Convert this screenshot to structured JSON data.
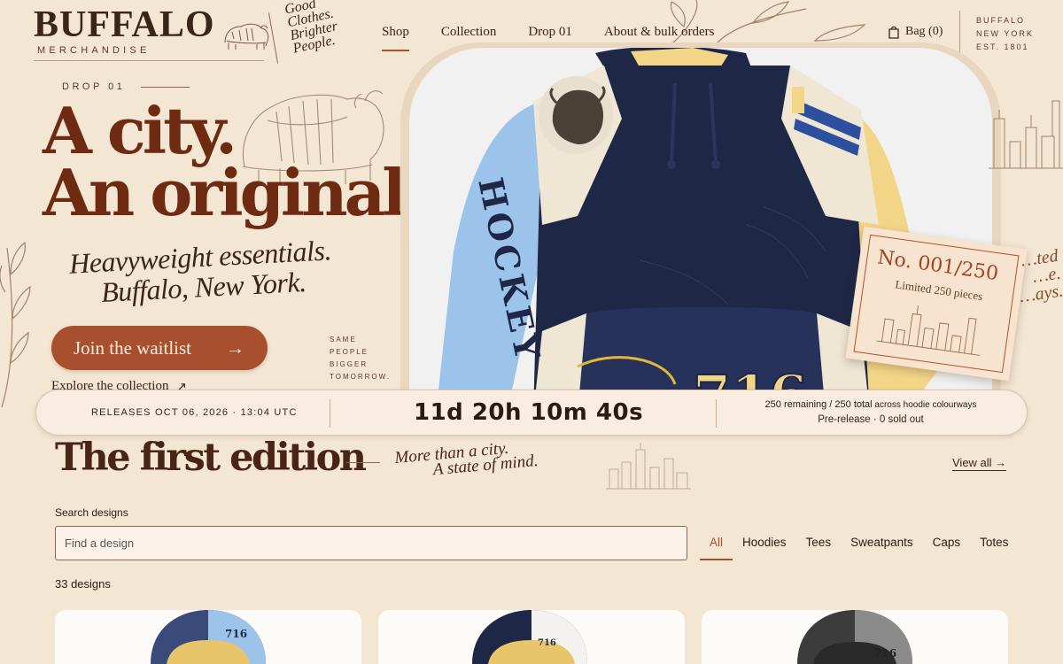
{
  "header": {
    "brand": "BUFFALO",
    "brand_sub": "MERCHANDISE",
    "slogan": [
      "Good",
      "Clothes.",
      "Brighter",
      "People."
    ],
    "nav": [
      "Shop",
      "Collection",
      "Drop 01",
      "About & bulk orders"
    ],
    "bag_label": "Bag (0)",
    "city_lines": [
      "BUFFALO",
      "NEW YORK",
      "EST. 1801"
    ]
  },
  "hero": {
    "drop_label": "DROP 01",
    "title_l1": "A city.",
    "title_l2": "An original.",
    "sub_l1": "Heavyweight essentials.",
    "sub_l2": "Buffalo, New York.",
    "waitlist_label": "Join the waitlist",
    "waitlist_arrow": "→",
    "poem": [
      "SAME",
      "PEOPLE",
      "BIGGER",
      "TOMORROW."
    ],
    "explore_label": "Explore the collection",
    "explore_arrow": "↗",
    "hoodie_sleeve_text": "HOCKEY",
    "hoodie_chest_text": "716",
    "card_number": "No. 001/250",
    "card_sub": "Limited 250 pieces",
    "side_script": [
      "…ted",
      "…e.",
      "…ays."
    ]
  },
  "countdown": {
    "release": "RELEASES OCT 06, 2026 · 13:04 UTC",
    "timer": "11d 20h 10m 40s",
    "remaining_strong": "250 remaining / 250 total",
    "remaining_rest": " across hoodie colourways",
    "status": "Pre-release · 0 sold out"
  },
  "section": {
    "title": "The first edition",
    "script_l1": "More than a city.",
    "script_l2": "A state of mind.",
    "view_all": "View all →"
  },
  "search": {
    "label": "Search designs",
    "placeholder": "Find a design",
    "value": ""
  },
  "filters": [
    "All",
    "Hoodies",
    "Tees",
    "Sweatpants",
    "Caps",
    "Totes"
  ],
  "active_filter": "All",
  "count_text": "33 designs",
  "products": [
    {
      "tag": "716"
    },
    {
      "tag": "716"
    },
    {
      "tag": "716"
    }
  ],
  "colors": {
    "background": "#f3e6d3",
    "brand_rust": "#a8502e",
    "headline_brown": "#6f2a12",
    "ink": "#3b2418",
    "navy": "#1e2746",
    "sky_blue": "#9cc4ea",
    "butter_yellow": "#f2d587"
  }
}
